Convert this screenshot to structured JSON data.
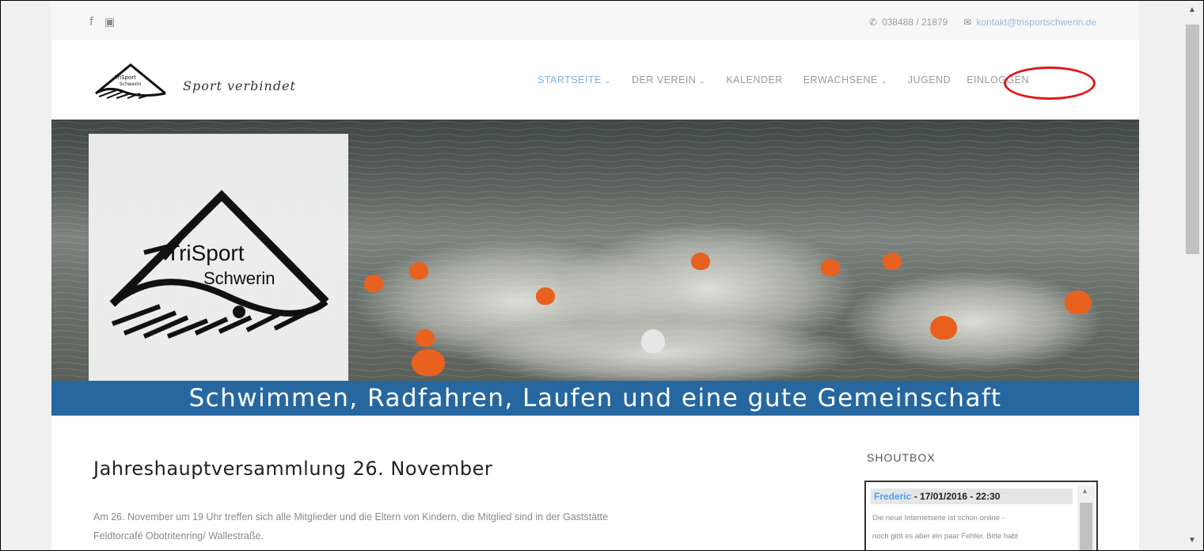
{
  "topbar": {
    "social_icons": [
      "facebook-icon",
      "youtube-icon"
    ],
    "facebook_glyph": "f",
    "youtube_glyph": "▣",
    "phone_glyph": "✆",
    "phone": "038488 / 21879",
    "mail_glyph": "✉",
    "email": "kontakt@trisportschwerin.de"
  },
  "header": {
    "logo_text_1": "TriSport",
    "logo_text_2": "Schwerin",
    "tagline": "Sport verbindet"
  },
  "nav": {
    "items": [
      {
        "label": "STARTSEITE",
        "has_dropdown": true,
        "active": true
      },
      {
        "label": "DER VEREIN",
        "has_dropdown": true,
        "active": false
      },
      {
        "label": "KALENDER",
        "has_dropdown": false,
        "active": false
      },
      {
        "label": "ERWACHSENE",
        "has_dropdown": true,
        "active": false
      },
      {
        "label": "JUGEND",
        "has_dropdown": false,
        "active": false
      },
      {
        "label": "EINLOGGEN",
        "has_dropdown": false,
        "active": false
      }
    ],
    "chevron": "⌄",
    "highlight_color": "#e0181a"
  },
  "hero": {
    "logo_line_1": "TriSport",
    "logo_line_2": "Schwerin",
    "banner_text": "Schwimmen, Radfahren, Laufen und eine gute Gemeinschaft",
    "banner_color": "#2767a0"
  },
  "article": {
    "title": "Jahreshauptversammlung 26. November",
    "body_line_1": "Am 26. November um 19 Uhr treffen sich alle Mitglieder und die Eltern von Kindern, die Mitglied sind in der Gaststätte",
    "body_line_2": "Feldtorcafé Obotritenring/ Wallestraße."
  },
  "sidebar": {
    "title": "SHOUTBOX",
    "shout": {
      "user": "Frederic",
      "meta": " - 17/01/2016 - 22:30",
      "line_1": "Die neue Internetseite ist schon online -",
      "line_2": "noch gibt es aber ein paar Fehler. Bitte habt"
    }
  },
  "colors": {
    "accent": "#7fb0dd",
    "text_muted": "#9a9a9a",
    "shout_user": "#4da3f5"
  }
}
